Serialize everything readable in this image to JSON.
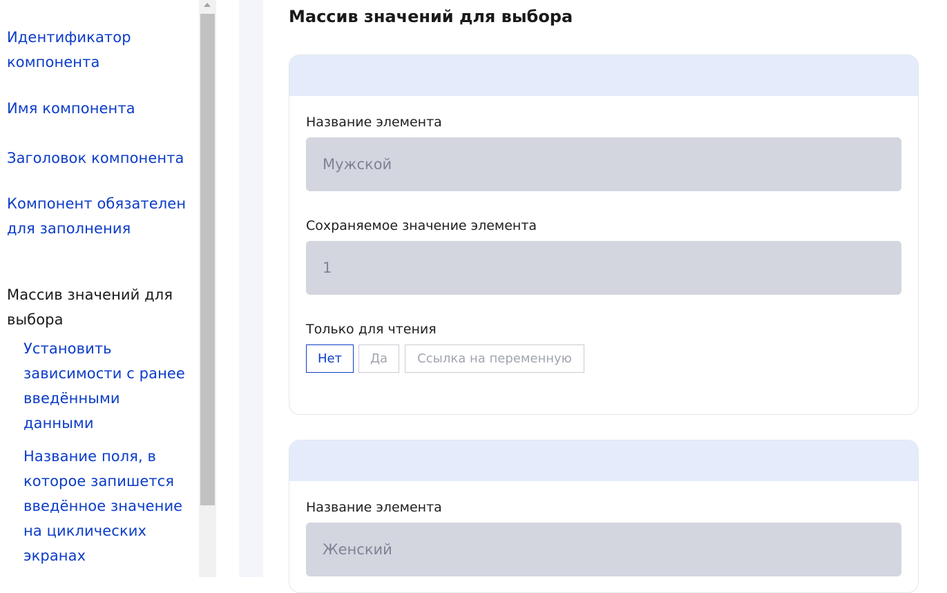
{
  "sidebar": {
    "items": [
      {
        "label": "Идентификатор компонента"
      },
      {
        "label": "Имя компонента"
      },
      {
        "label": "Заголовок компонента"
      },
      {
        "label": "Компонент обязателен для заполнения"
      },
      {
        "label": "Массив значений для выбора"
      },
      {
        "label": "Установить зависимости с ранее введёнными данными"
      },
      {
        "label": "Название поля, в которое запишется введённое значение на циклических экранах"
      }
    ]
  },
  "main": {
    "section_title": "Массив значений для выбора",
    "cards": [
      {
        "name_label": "Название элемента",
        "name_value": "Мужской",
        "saved_label": "Сохраняемое значение элемента",
        "saved_value": "1",
        "readonly_label": "Только для чтения",
        "readonly_options": [
          "Нет",
          "Да",
          "Ссылка на переменную"
        ],
        "readonly_selected": "Нет"
      },
      {
        "name_label": "Название элемента",
        "name_value": "Женский"
      }
    ]
  },
  "colors": {
    "link": "#0b3cc7",
    "card_header": "#e4ebfb",
    "input_bg": "#d3d5df",
    "gutter": "#f3f5fb"
  },
  "icons": [
    "scroll-up-arrow-icon"
  ]
}
